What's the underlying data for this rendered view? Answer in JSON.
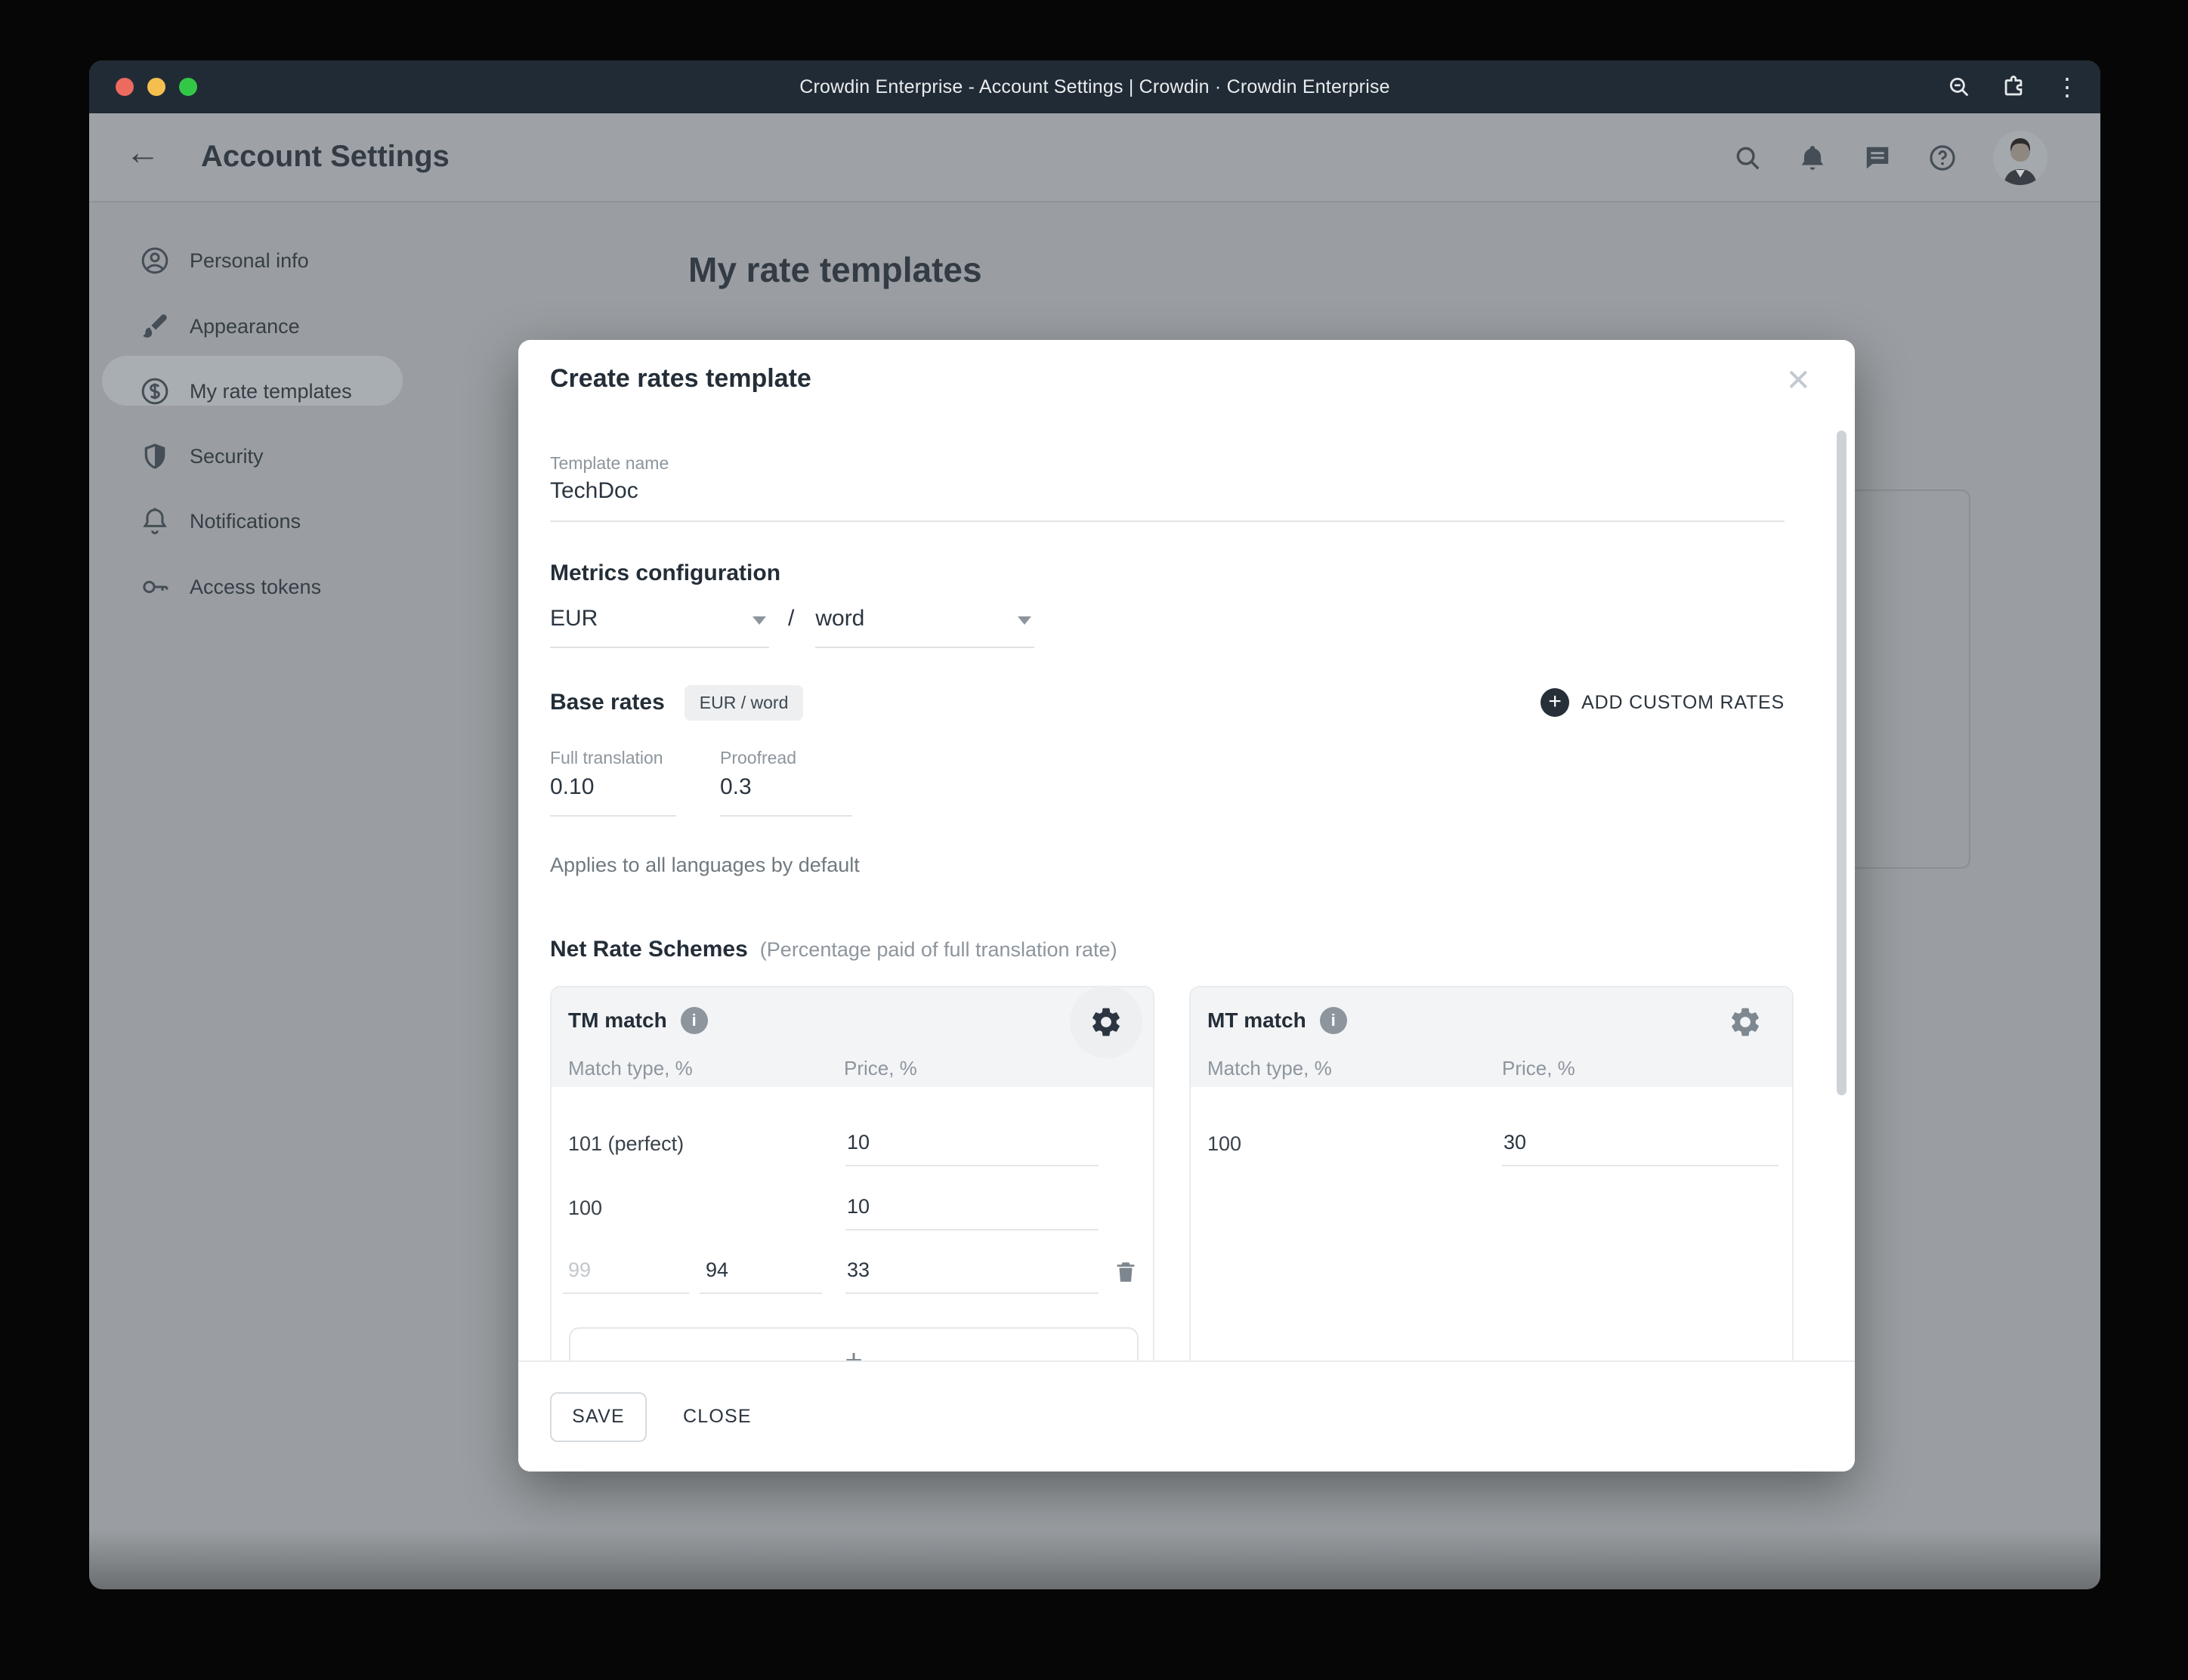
{
  "titlebar": {
    "title": "Crowdin Enterprise - Account Settings | Crowdin · Crowdin Enterprise",
    "menu_icon": "⋮"
  },
  "header": {
    "back_icon": "←",
    "title": "Account Settings"
  },
  "sidebar": {
    "items": [
      {
        "label": "Personal info",
        "icon": "user-circle-icon"
      },
      {
        "label": "Appearance",
        "icon": "brush-icon"
      },
      {
        "label": "My rate templates",
        "icon": "dollar-circle-icon",
        "selected": true
      },
      {
        "label": "Security",
        "icon": "shield-icon"
      },
      {
        "label": "Notifications",
        "icon": "bell-icon"
      },
      {
        "label": "Access tokens",
        "icon": "key-icon"
      }
    ]
  },
  "page": {
    "title": "My rate templates"
  },
  "modal": {
    "title": "Create rates template",
    "close_icon": "✕",
    "template_name": {
      "label": "Template name",
      "value": "TechDoc"
    },
    "metrics": {
      "heading": "Metrics configuration",
      "currency": "EUR",
      "slash": "/",
      "unit": "word"
    },
    "base_rates": {
      "heading": "Base rates",
      "chip": "EUR / word",
      "add_button": "ADD CUSTOM RATES",
      "plus_icon": "+",
      "fields": [
        {
          "label": "Full translation",
          "value": "0.10"
        },
        {
          "label": "Proofread",
          "value": "0.3"
        }
      ],
      "note": "Applies to all languages by default"
    },
    "schemes": {
      "heading": "Net Rate Schemes",
      "subheading": "(Percentage paid of full translation rate)",
      "columns": [
        "Match type, %",
        "Price, %"
      ],
      "info_icon": "i",
      "tm": {
        "title": "TM match",
        "rows": [
          {
            "match": "101 (perfect)",
            "price": "10"
          },
          {
            "match": "100",
            "price": "10"
          }
        ],
        "row3": {
          "match_placeholder": "99",
          "match_to": "94",
          "price": "33"
        },
        "add_row_icon": "+"
      },
      "mt": {
        "title": "MT match",
        "rows": [
          {
            "match": "100",
            "price": "30"
          }
        ]
      }
    },
    "footer": {
      "save": "SAVE",
      "close": "CLOSE"
    }
  },
  "colors": {
    "titlebar_bg": "#212b35",
    "traffic_red": "#ed6a5f",
    "traffic_yellow": "#f5bf4f",
    "traffic_green": "#33c748",
    "modal_bg": "#ffffff",
    "dimmed_page_bg": "#9a9ea2",
    "accent_dark": "#242e38",
    "label_gray": "#8d959d"
  }
}
